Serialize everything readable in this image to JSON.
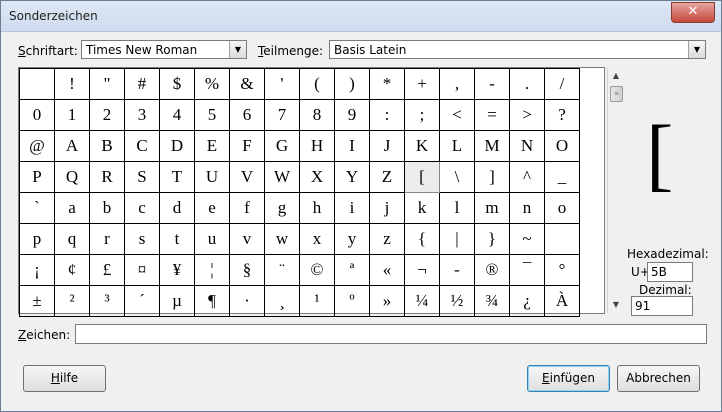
{
  "window": {
    "title": "Sonderzeichen",
    "close_glyph": "✕"
  },
  "font": {
    "label_prefix": "S",
    "label_rest": "chriftart:",
    "value": "Times New Roman"
  },
  "subset": {
    "label_prefix": "T",
    "label_rest": "eilmenge:",
    "value": "Basis Latein"
  },
  "grid": {
    "selected": "[",
    "rows": [
      [
        " ",
        "!",
        "\"",
        "#",
        "$",
        "%",
        "&",
        "'",
        "(",
        ")",
        "*",
        "+",
        ",",
        "-",
        ".",
        "/"
      ],
      [
        "0",
        "1",
        "2",
        "3",
        "4",
        "5",
        "6",
        "7",
        "8",
        "9",
        ":",
        ";",
        "<",
        "=",
        ">",
        "?"
      ],
      [
        "@",
        "A",
        "B",
        "C",
        "D",
        "E",
        "F",
        "G",
        "H",
        "I",
        "J",
        "K",
        "L",
        "M",
        "N",
        "O"
      ],
      [
        "P",
        "Q",
        "R",
        "S",
        "T",
        "U",
        "V",
        "W",
        "X",
        "Y",
        "Z",
        "[",
        "\\",
        "]",
        "^",
        "_"
      ],
      [
        "`",
        "a",
        "b",
        "c",
        "d",
        "e",
        "f",
        "g",
        "h",
        "i",
        "j",
        "k",
        "l",
        "m",
        "n",
        "o"
      ],
      [
        "p",
        "q",
        "r",
        "s",
        "t",
        "u",
        "v",
        "w",
        "x",
        "y",
        "z",
        "{",
        "|",
        "}",
        "~",
        ""
      ],
      [
        "¡",
        "¢",
        "£",
        "¤",
        "¥",
        "¦",
        "§",
        "¨",
        "©",
        "ª",
        "«",
        "¬",
        "-",
        "®",
        "¯",
        "°"
      ],
      [
        "±",
        "²",
        "³",
        "´",
        "µ",
        "¶",
        "·",
        "¸",
        "¹",
        "º",
        "»",
        "¼",
        "½",
        "¾",
        "¿",
        "À"
      ]
    ]
  },
  "preview": {
    "char": "["
  },
  "hex": {
    "label": "Hexadezimal:",
    "prefix": "U+",
    "value": "5B"
  },
  "dec": {
    "label": "Dezimal:",
    "value": "91"
  },
  "zeichen": {
    "label_prefix": "Z",
    "label_rest": "eichen:",
    "value": ""
  },
  "buttons": {
    "help_prefix": "H",
    "help_rest": "ilfe",
    "insert_prefix": "E",
    "insert_rest": "infügen",
    "cancel": "Abbrechen"
  },
  "icons": {
    "dropdown": "chevron-down-icon",
    "scroll_up": "arrow-up-icon",
    "scroll_down": "arrow-down-icon"
  }
}
